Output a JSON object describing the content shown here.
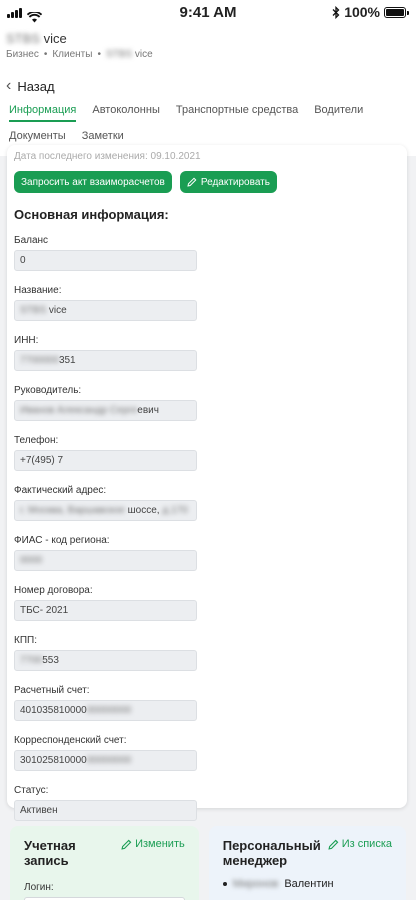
{
  "status_bar": {
    "time": "9:41 AM",
    "battery": "100%",
    "battery_level": 1.0
  },
  "header": {
    "company_name": "vice",
    "breadcrumb": [
      "Бизнес",
      "Клиенты",
      "vice"
    ],
    "back_label": "Назад"
  },
  "tabs": [
    {
      "label": "Информация",
      "active": true
    },
    {
      "label": "Автоколонны"
    },
    {
      "label": "Транспортные средства"
    },
    {
      "label": "Водители"
    },
    {
      "label": "Документы"
    },
    {
      "label": "Заметки"
    }
  ],
  "info": {
    "updated": "Дата последнего изменения: 09.10.2021",
    "request_button": "Запросить акт взаиморасчетов",
    "edit_button": "Редактировать",
    "section_title": "Основная информация:",
    "fields": [
      {
        "label": "Баланс",
        "value": "0"
      },
      {
        "label": "Название:",
        "value": "vice"
      },
      {
        "label": "ИНН:",
        "value": "351"
      },
      {
        "label": "Руководитель:",
        "value": "евич"
      },
      {
        "label": "Телефон:",
        "value": "+7(495) 7"
      },
      {
        "label": "Фактический адрес:",
        "value": "шоссе,"
      },
      {
        "label": "ФИАС - код региона:",
        "value": ""
      },
      {
        "label": "Номер договора:",
        "value": "ТБС- 2021"
      },
      {
        "label": "КПП:",
        "value": "553"
      },
      {
        "label": "Расчетный счет:",
        "value": "401035810000"
      },
      {
        "label": "Корреспонденский счет:",
        "value": "301025810000"
      },
      {
        "label": "Статус:",
        "value": "Активен"
      }
    ]
  },
  "account": {
    "title": "Учетная запись",
    "change_link": "Изменить",
    "login_label": "Логин:",
    "login_value": "•••••••••••••••••"
  },
  "manager": {
    "title": "Персональный менеджер",
    "list_link": "Из списка",
    "name": "Валентин"
  }
}
